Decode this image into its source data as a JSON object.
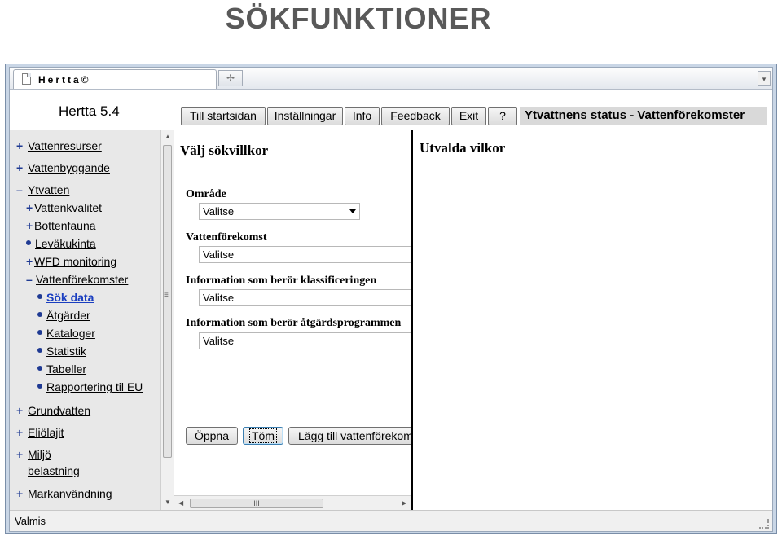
{
  "slide": {
    "title": "SÖKFUNKTIONER"
  },
  "browser": {
    "tab_title": "Hertta©",
    "new_tab_icon": "plus-icon"
  },
  "app": {
    "title": "Hertta 5.4",
    "nav": [
      "Till startsidan",
      "Inställningar",
      "Info",
      "Feedback",
      "Exit",
      "?"
    ],
    "page_header": "Ytvattnens status - Vattenförekomster"
  },
  "sidebar": {
    "items": [
      {
        "marker": "+",
        "label": "Vattenresurser"
      },
      {
        "marker": "+",
        "label": "Vattenbyggande"
      },
      {
        "marker": "–",
        "label": "Ytvatten"
      },
      {
        "marker": "+",
        "label": "Vattenkvalitet"
      },
      {
        "marker": "+",
        "label": "Bottenfauna"
      },
      {
        "marker": "•",
        "label": "Leväkukinta"
      },
      {
        "marker": "+",
        "label": "WFD monitoring"
      },
      {
        "marker": "–",
        "label": "Vattenförekomster"
      },
      {
        "marker": "•",
        "label": "Sök data"
      },
      {
        "marker": "•",
        "label": "Åtgärder"
      },
      {
        "marker": "•",
        "label": "Kataloger"
      },
      {
        "marker": "•",
        "label": "Statistik"
      },
      {
        "marker": "•",
        "label": "Tabeller"
      },
      {
        "marker": "•",
        "label": "Rapportering til EU"
      },
      {
        "marker": "+",
        "label": "Grundvatten"
      },
      {
        "marker": "+",
        "label": "Eliölajit"
      },
      {
        "marker": "+",
        "label": "Miljö",
        "label2": "belastning"
      },
      {
        "marker": "+",
        "label": "Markanvändning"
      }
    ]
  },
  "search": {
    "heading": "Välj sökvillkor",
    "fields": [
      {
        "label": "Område",
        "value": "Valitse"
      },
      {
        "label": "Vattenförekomst",
        "value": "Valitse"
      },
      {
        "label": "Information som berör klassificeringen",
        "value": "Valitse"
      },
      {
        "label": "Information som berör åtgärdsprogrammen",
        "value": "Valitse"
      }
    ],
    "buttons": [
      "Öppna",
      "Töm",
      "Lägg till vattenförekomster"
    ]
  },
  "selected": {
    "heading": "Utvalda vilkor"
  },
  "status": {
    "text": "Valmis"
  },
  "scroll": {
    "h_grip": "III",
    "v_grip": "≡"
  }
}
